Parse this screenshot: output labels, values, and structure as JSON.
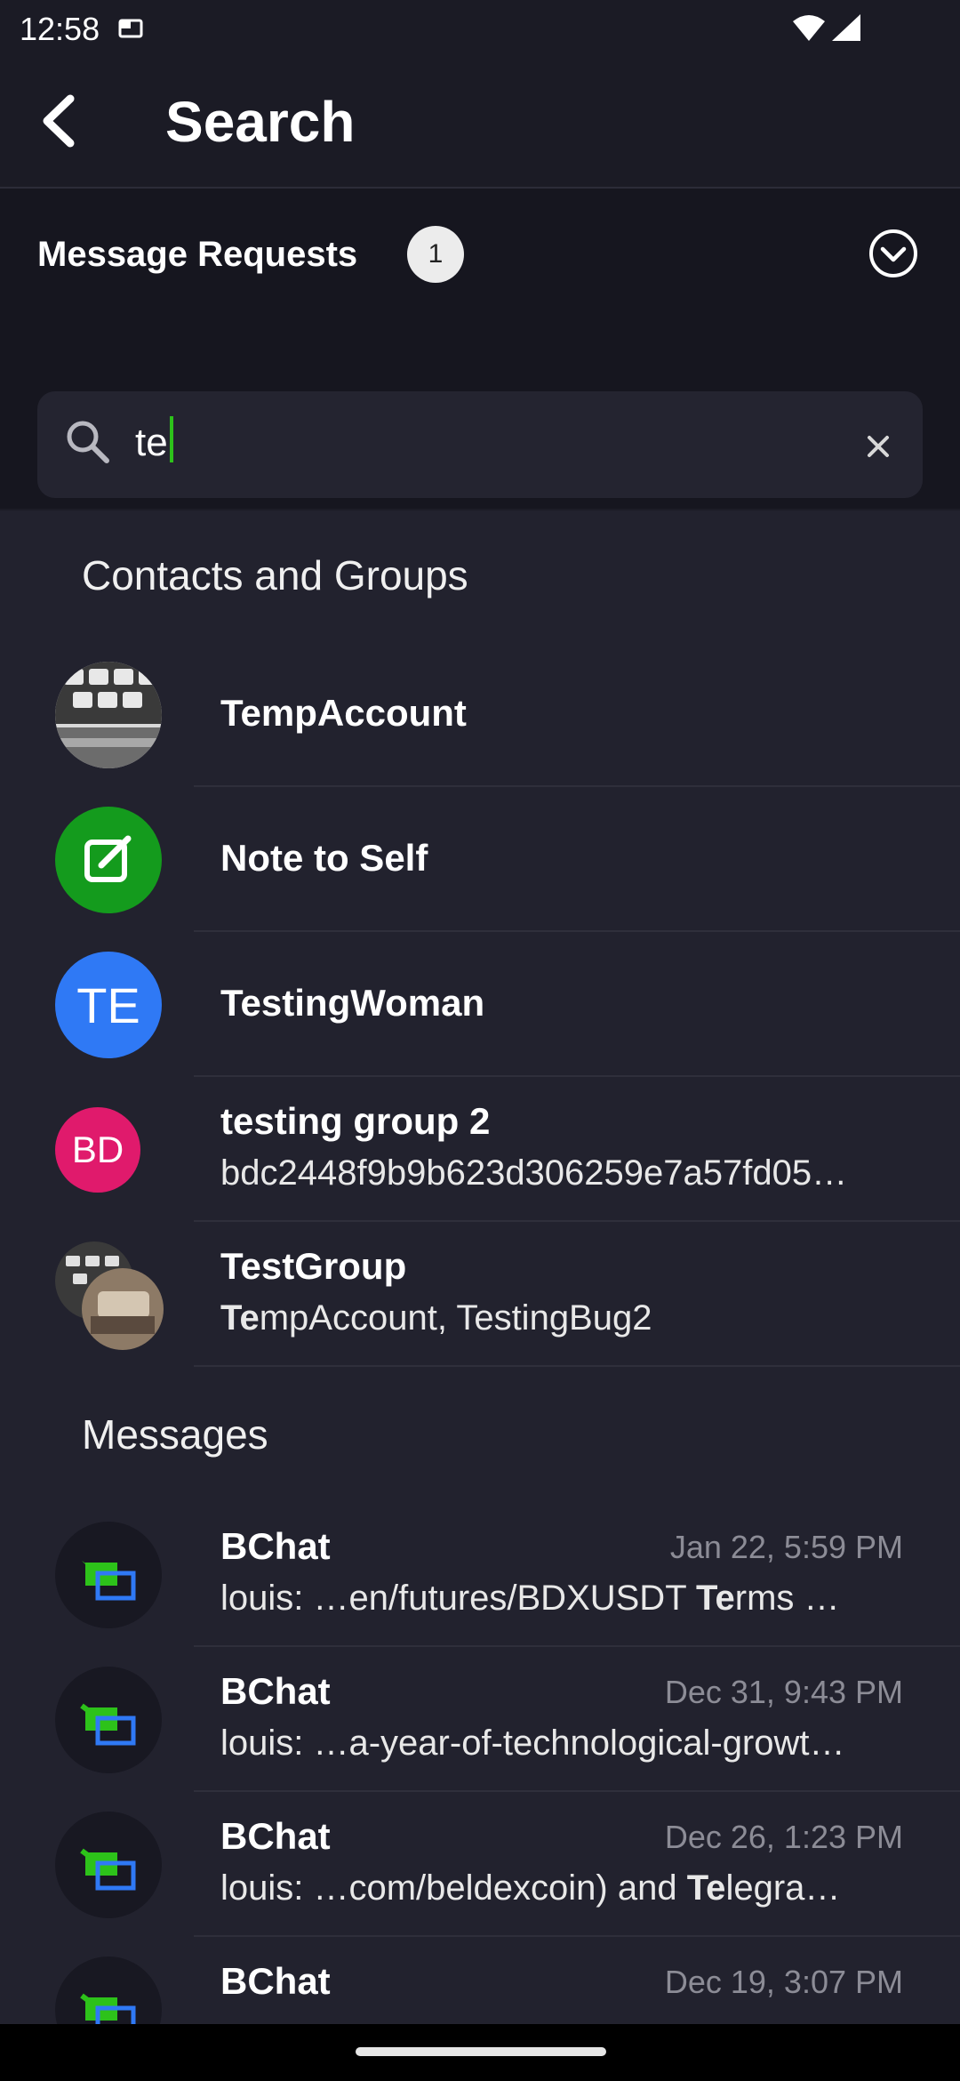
{
  "status_bar": {
    "time": "12:58"
  },
  "header": {
    "title": "Search"
  },
  "message_requests": {
    "label": "Message Requests",
    "count": "1"
  },
  "search": {
    "value": "te"
  },
  "contacts_section": {
    "title": "Contacts and Groups",
    "items": [
      {
        "name": "TempAccount",
        "subtitle": "",
        "avatar_type": "photo-keyboard"
      },
      {
        "name": "Note to Self",
        "subtitle": "",
        "avatar_type": "note-icon",
        "avatar_color": "#149b1d"
      },
      {
        "name": "TestingWoman",
        "subtitle": "",
        "avatar_initials": "TE",
        "avatar_color": "#2f79f5"
      },
      {
        "name": "testing group 2",
        "subtitle": "bdc2448f9b9b623d306259e7a57fd05…",
        "avatar_initials": "BD",
        "avatar_color": "#e01a6c"
      },
      {
        "name": "TestGroup",
        "subtitle_bold": "Te",
        "subtitle_rest": "mpAccount, TestingBug2",
        "avatar_type": "group-photos"
      }
    ]
  },
  "messages_section": {
    "title": "Messages",
    "items": [
      {
        "name": "BChat",
        "date": "Jan 22, 5:59 PM",
        "snippet_pre": "louis: …en/futures/BDXUSDT  ",
        "snippet_bold": "Te",
        "snippet_post": "rms …"
      },
      {
        "name": "BChat",
        "date": "Dec 31, 9:43 PM",
        "snippet_pre": "louis: …a-year-of-technological-growt…",
        "snippet_bold": "",
        "snippet_post": ""
      },
      {
        "name": "BChat",
        "date": "Dec 26, 1:23 PM",
        "snippet_pre": "louis: …com/beldexcoin) and ",
        "snippet_bold": "Te",
        "snippet_post": "legra…"
      },
      {
        "name": "BChat",
        "date": "Dec 19, 3:07 PM",
        "snippet_pre": "",
        "snippet_bold": "",
        "snippet_post": ""
      }
    ]
  },
  "colors": {
    "accent": "#2dc21a",
    "background": "#22222e",
    "header_bg": "#1b1b25"
  }
}
